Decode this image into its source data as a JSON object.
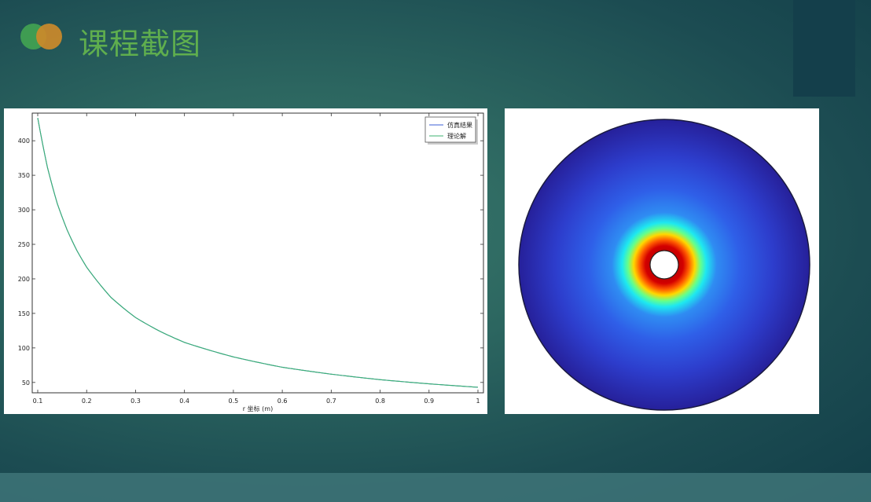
{
  "slide": {
    "title": "课程截图",
    "colors": {
      "logo_green": "#3f9c52",
      "logo_orange": "#cc8a2a",
      "title_green": "#5fae4e"
    }
  },
  "chart_data": {
    "type": "line",
    "xlabel": "r 坐标 (m)",
    "ylabel": "",
    "xlim": [
      0.1,
      1.0
    ],
    "ylim": [
      35,
      440
    ],
    "xticks": [
      "0.1",
      "0.2",
      "0.3",
      "0.4",
      "0.5",
      "0.6",
      "0.7",
      "0.8",
      "0.9",
      "1"
    ],
    "yticks": [
      "50",
      "100",
      "150",
      "200",
      "250",
      "300",
      "350",
      "400"
    ],
    "grid": false,
    "legend": {
      "position": "top-right",
      "entries": [
        "仿真结果",
        "理论解"
      ]
    },
    "series": [
      {
        "name": "仿真结果",
        "color": "#3b5fd6",
        "x": [
          0.1,
          0.12,
          0.14,
          0.16,
          0.18,
          0.2,
          0.25,
          0.3,
          0.35,
          0.4,
          0.5,
          0.6,
          0.7,
          0.8,
          0.9,
          1.0
        ],
        "y": [
          433,
          361,
          309,
          271,
          241,
          217,
          173,
          144,
          124,
          108,
          87,
          72,
          62,
          54,
          48,
          43
        ]
      },
      {
        "name": "理论解",
        "color": "#3cb371",
        "x": [
          0.1,
          0.12,
          0.14,
          0.16,
          0.18,
          0.2,
          0.25,
          0.3,
          0.35,
          0.4,
          0.5,
          0.6,
          0.7,
          0.8,
          0.9,
          1.0
        ],
        "y": [
          433,
          361,
          309,
          271,
          241,
          217,
          173,
          144,
          124,
          108,
          87,
          72,
          62,
          54,
          48,
          43
        ]
      }
    ]
  },
  "field_plot": {
    "type": "annulus-color-map",
    "colormap": [
      "#8a0000",
      "#d40000",
      "#ff5a00",
      "#ffd800",
      "#66ff8a",
      "#1ee8f0",
      "#2f8cf2",
      "#2f5fe8",
      "#2d3dcc",
      "#26209a"
    ]
  }
}
